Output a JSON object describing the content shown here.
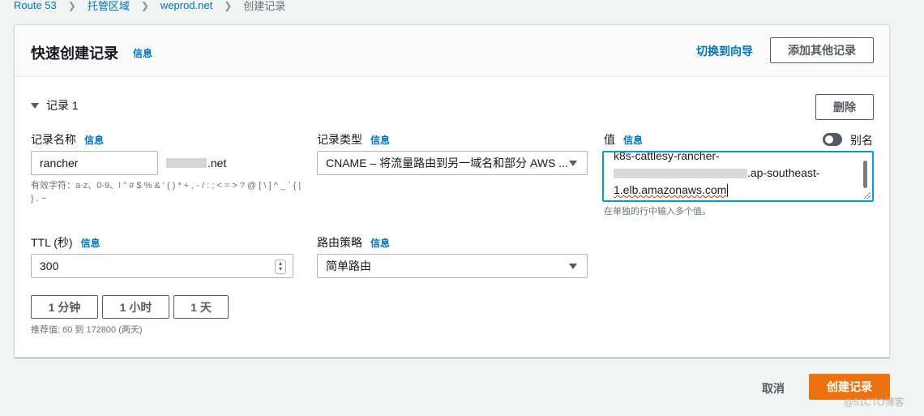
{
  "breadcrumb": {
    "items": [
      "Route 53",
      "托管区域",
      "weprod.net"
    ],
    "current": "创建记录"
  },
  "header": {
    "title": "快速创建记录",
    "info": "信息",
    "switch_link": "切换到向导",
    "add_button": "添加其他记录"
  },
  "record": {
    "label": "记录 1",
    "delete_button": "删除",
    "name": {
      "label": "记录名称",
      "info": "信息",
      "value": "rancher",
      "domain_suffix": ".net",
      "hint": "有效字符：a-z、0-9、! \" # $ % & ' ( ) * + , - / : ; < = > ? @ [ \\ ] ^ _ ` { | } . ~"
    },
    "type": {
      "label": "记录类型",
      "info": "信息",
      "value": "CNAME – 将流量路由到另一域名和部分 AWS ..."
    },
    "value": {
      "label": "值",
      "info": "信息",
      "alias_label": "别名",
      "line1": "k8s-cattlesy-rancher-",
      "line2_suffix": ".ap-southeast-",
      "line3": "1.elb.amazonaws.com",
      "hint": "在单独的行中输入多个值。"
    },
    "ttl": {
      "label": "TTL (秒)",
      "info": "信息",
      "value": "300",
      "presets": [
        "1 分钟",
        "1 小时",
        "1 天"
      ],
      "hint": "推荐值: 60 到 172800 (两天)"
    },
    "routing": {
      "label": "路由策略",
      "info": "信息",
      "value": "简单路由"
    }
  },
  "footer": {
    "cancel": "取消",
    "create": "创建记录"
  },
  "watermark": "@51CTO博客"
}
